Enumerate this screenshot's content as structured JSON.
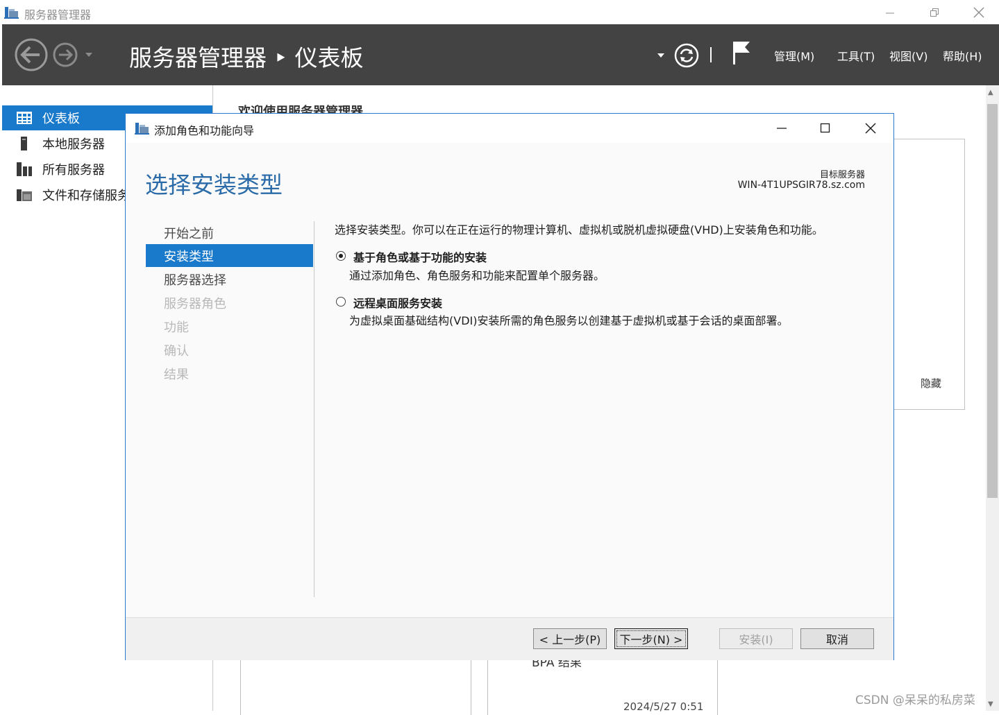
{
  "window": {
    "title": "服务器管理器",
    "minimize_icon": "minimize-icon",
    "restore_icon": "restore-icon",
    "close_icon": "close-icon"
  },
  "header": {
    "title": "服务器管理器 ‣ 仪表板",
    "menu": [
      "管理(M)",
      "工具(T)",
      "视图(V)",
      "帮助(H)"
    ],
    "background_color": "#434343"
  },
  "nav": {
    "items": [
      {
        "label": "仪表板",
        "icon": "dashboard-icon",
        "active": true
      },
      {
        "label": "本地服务器",
        "icon": "server-icon",
        "active": false
      },
      {
        "label": "所有服务器",
        "icon": "servers-icon",
        "active": false
      },
      {
        "label": "文件和存储服务",
        "icon": "storage-icon",
        "active": false
      }
    ],
    "active_color": "#1979ca"
  },
  "background": {
    "welcome": "欢迎使用服务器管理器",
    "hide_label": "隐藏",
    "bpa_label": "BPA 结果",
    "timestamp": "2024/5/27 0:51"
  },
  "wizard": {
    "title": "添加角色和功能向导",
    "heading": "选择安装类型",
    "target_label": "目标服务器",
    "target_value": "WIN-4T1UPSGIR78.sz.com",
    "steps": [
      {
        "label": "开始之前",
        "state": "done"
      },
      {
        "label": "安装类型",
        "state": "current"
      },
      {
        "label": "服务器选择",
        "state": "next"
      },
      {
        "label": "服务器角色",
        "state": "disabled"
      },
      {
        "label": "功能",
        "state": "disabled"
      },
      {
        "label": "确认",
        "state": "disabled"
      },
      {
        "label": "结果",
        "state": "disabled"
      }
    ],
    "intro": "选择安装类型。你可以在正在运行的物理计算机、虚拟机或脱机虚拟硬盘(VHD)上安装角色和功能。",
    "options": [
      {
        "title": "基于角色或基于功能的安装",
        "description": "通过添加角色、角色服务和功能来配置单个服务器。",
        "selected": true
      },
      {
        "title": "远程桌面服务安装",
        "description": "为虚拟桌面基础结构(VDI)安装所需的角色服务以创建基于虚拟机或基于会话的桌面部署。",
        "selected": false
      }
    ],
    "buttons": {
      "previous": "< 上一步(P)",
      "next": "下一步(N) >",
      "install": "安装(I)",
      "cancel": "取消"
    },
    "accent_color": "#2a6ba8"
  },
  "watermark": "CSDN @呆呆的私房菜"
}
